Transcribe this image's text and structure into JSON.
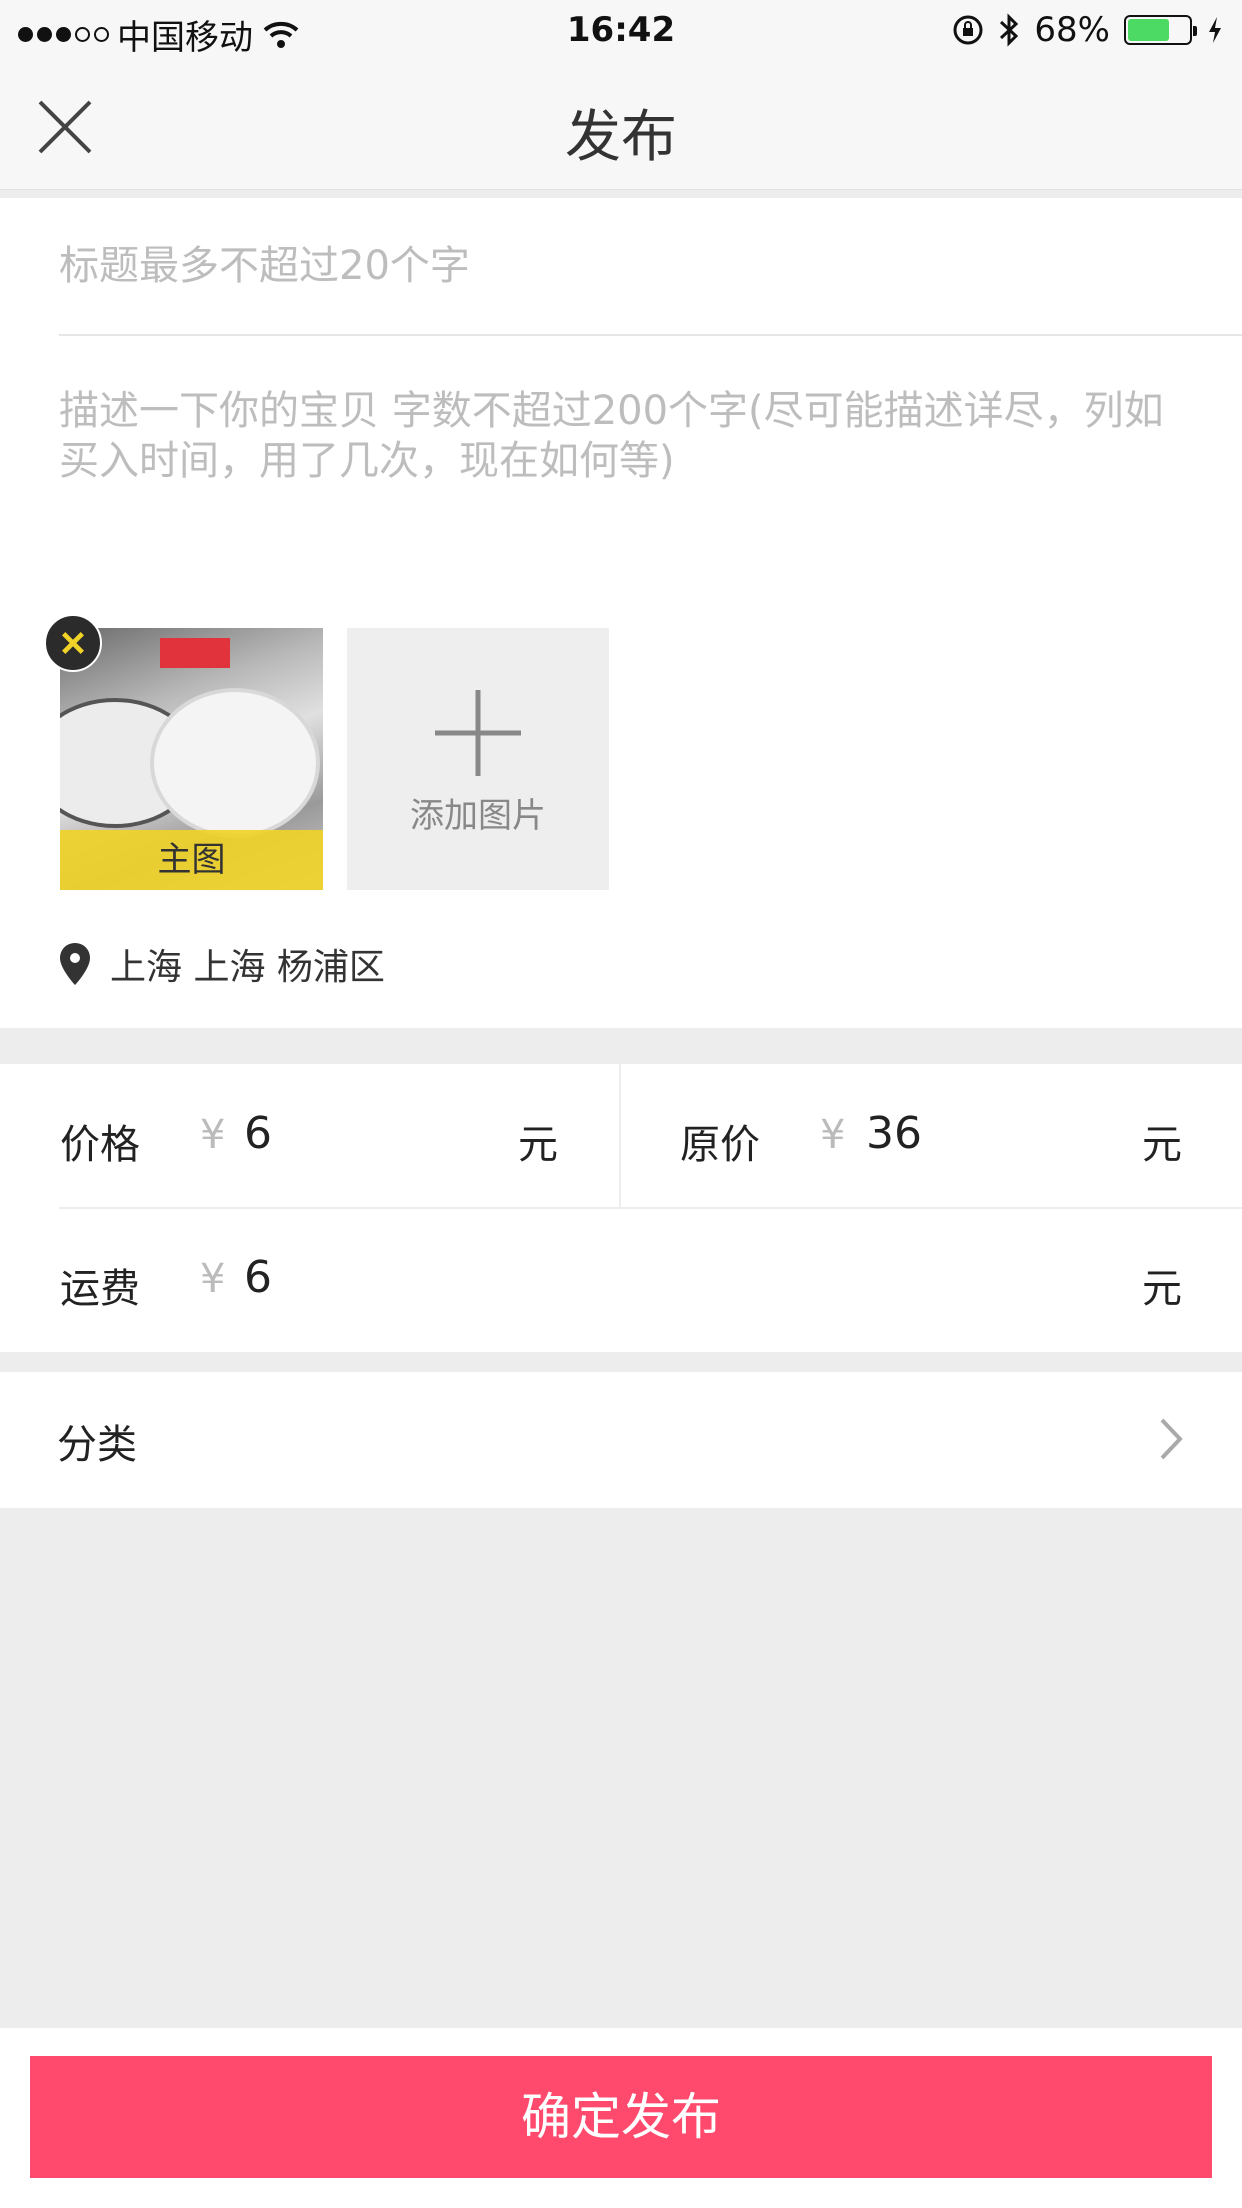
{
  "status_bar": {
    "carrier": "中国移动",
    "time": "16:42",
    "battery_percent": "68%",
    "battery_level": 0.68
  },
  "nav": {
    "title": "发布"
  },
  "form": {
    "title_placeholder": "标题最多不超过20个字",
    "desc_placeholder": "描述一下你的宝贝 字数不超过200个字(尽可能描述详尽，列如买入时间，用了几次，现在如何等)",
    "main_photo_label": "主图",
    "add_photo_label": "添加图片",
    "location": "上海 上海 杨浦区"
  },
  "pricing": {
    "price_label": "价格",
    "price_value": "6",
    "original_label": "原价",
    "original_value": "36",
    "shipping_label": "运费",
    "shipping_value": "6",
    "currency": "¥",
    "unit": "元"
  },
  "category": {
    "label": "分类"
  },
  "footer": {
    "publish_label": "确定发布"
  },
  "colors": {
    "accent": "#ff4a6e",
    "label_yellow": "#f0d228",
    "battery_green": "#4cd964"
  },
  "icons": [
    "wifi-icon",
    "rotation-lock-icon",
    "bluetooth-icon",
    "charging-icon",
    "close-icon",
    "remove-icon",
    "plus-icon",
    "location-pin-icon",
    "chevron-right-icon"
  ]
}
